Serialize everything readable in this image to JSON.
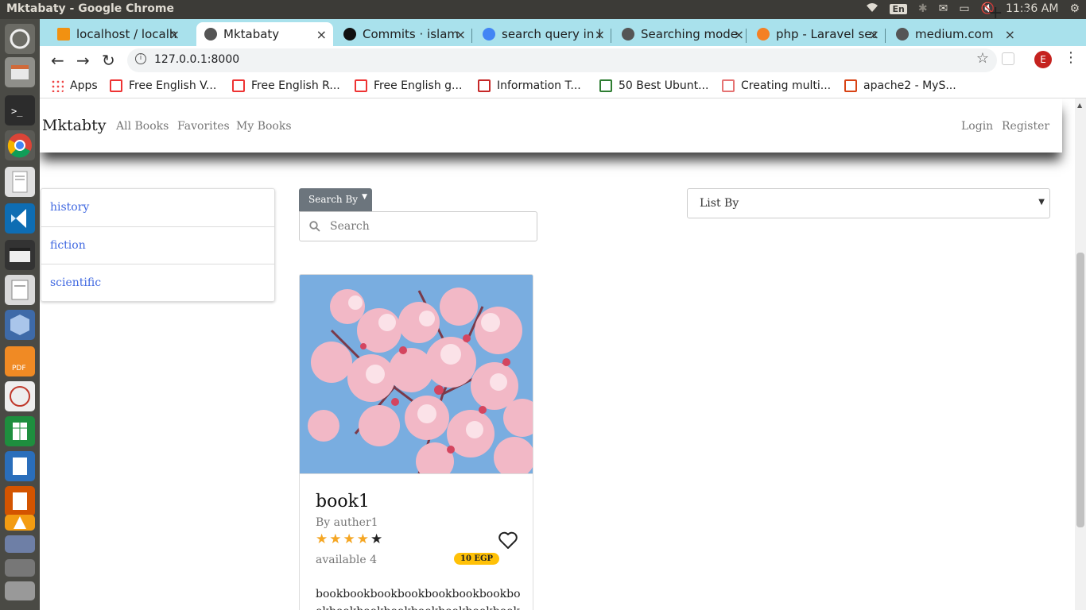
{
  "os": {
    "window_title": "Mktabaty - Google Chrome",
    "keyboard_layout": "En",
    "clock": "11:36 AM"
  },
  "browser": {
    "tabs": [
      {
        "label": "localhost / localhost",
        "favicon": "phpmyadmin-icon",
        "active": false
      },
      {
        "label": "Mktabaty",
        "favicon": "globe-icon",
        "active": true
      },
      {
        "label": "Commits · islam",
        "favicon": "github-icon",
        "active": false
      },
      {
        "label": "search query in l",
        "favicon": "google-icon",
        "active": false
      },
      {
        "label": "Searching mode",
        "favicon": "globe-icon",
        "active": false
      },
      {
        "label": "php - Laravel sea",
        "favicon": "stackoverflow-icon",
        "active": false
      },
      {
        "label": "medium.com",
        "favicon": "globe-icon",
        "active": false
      }
    ],
    "url": "127.0.0.1:8000",
    "profile_initial": "E",
    "bookmarks": [
      {
        "label": "Apps",
        "icon": "apps-grid-icon"
      },
      {
        "label": "Free English V...",
        "icon": "bookmark-icon"
      },
      {
        "label": "Free English R...",
        "icon": "bookmark-icon"
      },
      {
        "label": "Free English g...",
        "icon": "bookmark-icon"
      },
      {
        "label": "Information T...",
        "icon": "bookmark-icon"
      },
      {
        "label": "50 Best Ubunt...",
        "icon": "bookmark-icon"
      },
      {
        "label": "Creating multi...",
        "icon": "bookmark-icon"
      },
      {
        "label": "apache2 - MyS...",
        "icon": "bookmark-icon"
      }
    ],
    "bookmarks_more": "»"
  },
  "site": {
    "brand": "Mktabty",
    "nav_links": [
      "All Books",
      "Favorites",
      "My Books"
    ],
    "auth_links": [
      "Login",
      "Register"
    ],
    "categories": [
      "history",
      "fiction",
      "scientific"
    ],
    "search_by_label": "Search By",
    "search_placeholder": "Search",
    "list_by_label": "List By"
  },
  "book": {
    "title": "book1",
    "author": "By auther1",
    "rating": 4,
    "rating_max": 5,
    "availability": "available 4",
    "price": "10 EGP",
    "description": "bookbookbookbookbookbookbookbookbookbookbookbookbookbookbookbook"
  },
  "colors": {
    "tab_strip": "#a9e1ec",
    "link_blue": "#4169e1",
    "star_filled": "#f5a623",
    "star_empty": "#222222",
    "price_badge": "#ffc107",
    "search_by_bg": "#6c757d"
  }
}
